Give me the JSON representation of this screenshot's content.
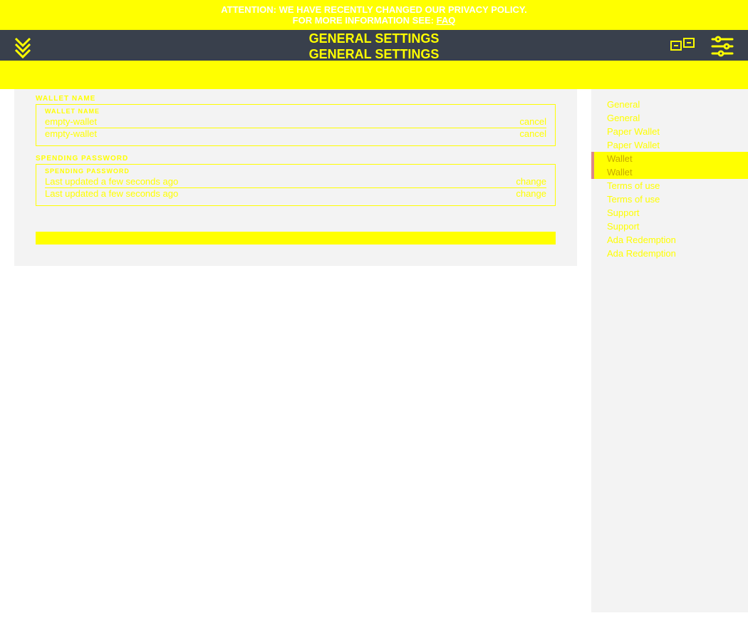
{
  "banner": {
    "line1": "ATTENTION: WE HAVE RECENTLY CHANGED OUR PRIVACY POLICY.",
    "line2_prefix": "FOR MORE INFORMATION SEE: ",
    "faq": "FAQ"
  },
  "header": {
    "title1": "GENERAL SETTINGS",
    "title2": "GENERAL SETTINGS"
  },
  "walletName": {
    "label_outer": "WALLET NAME",
    "label_inner": "WALLET NAME",
    "rows": [
      {
        "value": "empty-wallet",
        "action": "cancel"
      },
      {
        "value": "empty-wallet",
        "action": "cancel"
      }
    ]
  },
  "spendingPassword": {
    "label_outer": "SPENDING PASSWORD",
    "label_inner": "SPENDING PASSWORD",
    "rows": [
      {
        "value": "Last updated a few seconds ago",
        "action": "change"
      },
      {
        "value": "Last updated a few seconds ago",
        "action": "change"
      }
    ]
  },
  "sidebar": {
    "items": [
      {
        "label": "General",
        "active": false
      },
      {
        "label": "General",
        "active": false
      },
      {
        "label": "Paper Wallet",
        "active": false
      },
      {
        "label": "Paper Wallet",
        "active": false
      },
      {
        "label": "Wallet",
        "active": true
      },
      {
        "label": "Wallet",
        "active": true
      },
      {
        "label": "Terms of use",
        "active": false
      },
      {
        "label": "Terms of use",
        "active": false
      },
      {
        "label": "Support",
        "active": false
      },
      {
        "label": "Support",
        "active": false
      },
      {
        "label": "Ada Redemption",
        "active": false
      },
      {
        "label": "Ada Redemption",
        "active": false
      }
    ]
  }
}
